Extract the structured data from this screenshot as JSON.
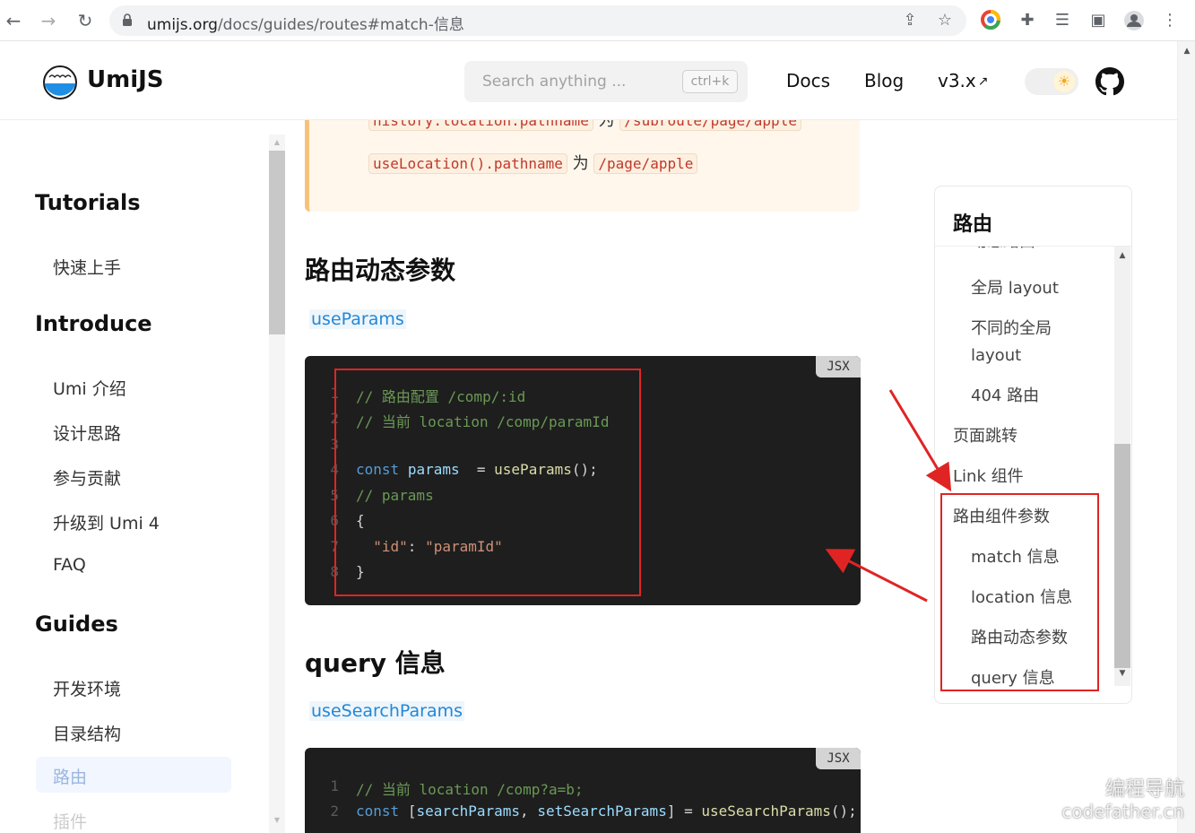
{
  "browser": {
    "url_host": "umijs.org",
    "url_path": "/docs/guides/routes#match-信息"
  },
  "header": {
    "logo_text": "UmiJS",
    "search_placeholder": "Search anything ...",
    "search_shortcut": "ctrl+k",
    "nav": {
      "docs": "Docs",
      "blog": "Blog",
      "version": "v3.x"
    }
  },
  "sidebar": {
    "sections": [
      {
        "title": "Tutorials",
        "items": [
          "快速上手"
        ]
      },
      {
        "title": "Introduce",
        "items": [
          "Umi 介绍",
          "设计思路",
          "参与贡献",
          "升级到 Umi 4",
          "FAQ"
        ]
      },
      {
        "title": "Guides",
        "items": [
          "开发环境",
          "目录结构",
          "路由",
          "插件"
        ]
      }
    ],
    "active_item": "路由"
  },
  "main": {
    "tip": {
      "line1_code1": "history.location.pathname",
      "line1_mid": "为",
      "line1_code2": "/subroute/page/apple",
      "line2_code1": "useLocation().pathname",
      "line2_mid": "为",
      "line2_code2": "/page/apple"
    },
    "section1": {
      "title": "路由动态参数",
      "link": "useParams",
      "lang": "JSX",
      "lines": [
        "// 路由配置 /comp/:id",
        "// 当前 location /comp/paramId",
        "",
        "const params  = useParams();",
        "// params",
        "{",
        "  \"id\": \"paramId\"",
        "}"
      ]
    },
    "section2": {
      "title": "query 信息",
      "link": "useSearchParams",
      "lang": "JSX",
      "lines": [
        "// 当前 location /comp?a=b;",
        "const [searchParams, setSearchParams] = useSearchParams();"
      ]
    }
  },
  "toc": {
    "title": "路由",
    "items": [
      {
        "level": 2,
        "label": "动态路由"
      },
      {
        "level": 2,
        "label": "全局 layout"
      },
      {
        "level": 2,
        "label": "不同的全局 layout"
      },
      {
        "level": 2,
        "label": "404 路由"
      },
      {
        "level": 1,
        "label": "页面跳转"
      },
      {
        "level": 1,
        "label": "Link 组件"
      },
      {
        "level": 1,
        "label": "路由组件参数"
      },
      {
        "level": 2,
        "label": "match 信息"
      },
      {
        "level": 2,
        "label": "location 信息"
      },
      {
        "level": 2,
        "label": "路由动态参数"
      },
      {
        "level": 2,
        "label": "query 信息"
      }
    ]
  },
  "watermark": {
    "line1": "编程导航",
    "line2": "codefather.cn"
  },
  "colors": {
    "link": "#2387d6",
    "annotation_red": "#e02424",
    "code_bg": "#1e1e1e",
    "tip_border": "#f8c17a"
  }
}
